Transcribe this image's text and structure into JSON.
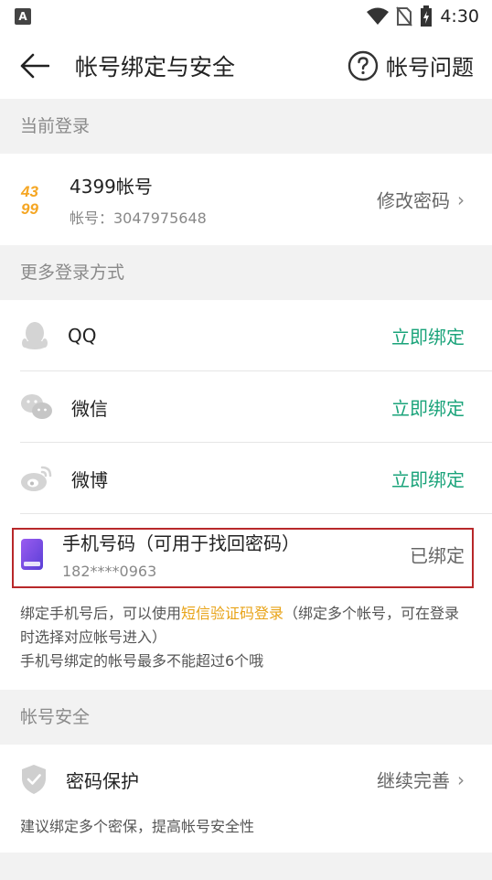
{
  "status": {
    "badge": "A",
    "time": "4:30"
  },
  "header": {
    "title": "帐号绑定与安全",
    "help_label": "帐号问题"
  },
  "sections": {
    "current_login": "当前登录",
    "more_login": "更多登录方式",
    "security": "帐号安全"
  },
  "account": {
    "logo_top": "43",
    "logo_bottom": "99",
    "name": "4399帐号",
    "id_text": "帐号：3047975648",
    "action": "修改密码"
  },
  "login_methods": [
    {
      "label": "QQ",
      "action": "立即绑定"
    },
    {
      "label": "微信",
      "action": "立即绑定"
    },
    {
      "label": "微博",
      "action": "立即绑定"
    }
  ],
  "phone": {
    "title": "手机号码（可用于找回密码）",
    "number": "182****0963",
    "status": "已绑定"
  },
  "notes": {
    "line1_before": "绑定手机号后，可以使用",
    "line1_link": "短信验证码登录",
    "line1_after": "（绑定多个帐号，可在登录时选择对应帐号进入）",
    "line2": "手机号绑定的帐号最多不能超过6个哦"
  },
  "security_item": {
    "label": "密码保护",
    "action": "继续完善",
    "note": "建议绑定多个密保，提高帐号安全性"
  },
  "colors": {
    "accent_green": "#1aa37a",
    "link_orange": "#e8a317",
    "highlight_red": "#b8282a",
    "phone_icon_purple": "#7b4fe0"
  }
}
